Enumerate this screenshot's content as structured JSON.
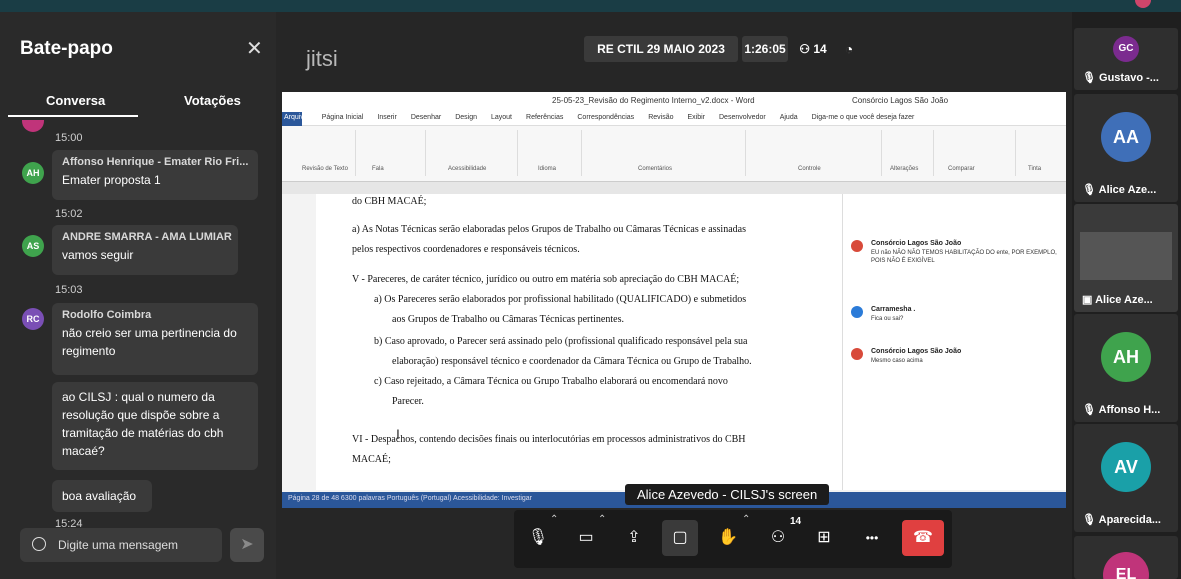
{
  "chat": {
    "title": "Bate-papo",
    "close_icon": "close-icon",
    "tabs": [
      "Conversa",
      "Votações"
    ],
    "messages": [
      {
        "time": "15:00"
      },
      {
        "initials": "AH",
        "color": "#3fa34d",
        "name": "Affonso Henrique - Emater Rio Fri...",
        "text": "Emater proposta 1",
        "time": "15:02"
      },
      {
        "initials": "AS",
        "color": "#3fa34d",
        "name": "ANDRE SMARRA - AMA LUMIAR",
        "text": "vamos seguir",
        "time": "15:03"
      },
      {
        "initials": "RC",
        "color": "#7a4fb5",
        "name": "Rodolfo Coimbra",
        "text": "não creio ser uma pertinencia do regimento"
      },
      {
        "text": "ao CILSJ : qual o numero da resolução que dispõe sobre a tramitação de matérias do cbh macaé?"
      },
      {
        "text": "boa avaliação",
        "time": "15:24"
      }
    ],
    "compose_placeholder": "Digite uma mensagem"
  },
  "header": {
    "logo": "jitsi",
    "meeting_title": "RE CTIL 29 MAIO 2023",
    "timer": "1:26:05",
    "participants_count": "14"
  },
  "shared_screen": {
    "label": "Alice Azevedo - CILSJ's screen",
    "word_title": "25-05-23_Revisão do Regimento Interno_v2.docx - Word",
    "word_user": "Consórcio Lagos São João",
    "ribbon_tabs": [
      "Arquivo",
      "Página Inicial",
      "Inserir",
      "Desenhar",
      "Design",
      "Layout",
      "Referências",
      "Correspondências",
      "Revisão",
      "Exibir",
      "Desenvolvedor",
      "Ajuda",
      "Diga-me o que você deseja fazer"
    ],
    "ribbon_groups": [
      "Revisão de Texto",
      "Fala",
      "Acessibilidade",
      "Idioma",
      "Comentários",
      "Controle",
      "Alterações",
      "Comparar",
      "Tinta"
    ],
    "doc_lines": [
      "do CBH MACAÉ;",
      "a) As Notas Técnicas serão elaboradas pelos Grupos de Trabalho ou Câmaras Técnicas e assinadas",
      "pelos respectivos coordenadores e responsáveis técnicos.",
      "V  - Pareceres, de caráter técnico, jurídico ou outro em matéria sob apreciação do CBH MACAÉ;",
      "a)  Os Pareceres serão elaborados por profissional habilitado (QUALIFICADO) e submetidos",
      "aos Grupos de Trabalho ou Câmaras Técnicas pertinentes.",
      "b)  Caso aprovado, o Parecer será assinado pelo (profissional qualificado responsável pela sua",
      "elaboração) responsável técnico e coordenador da Câmara Técnica ou Grupo de Trabalho.",
      "c)  Caso rejeitado, a Câmara Técnica ou Grupo Trabalho elaborará ou encomendará novo",
      "Parecer.",
      "VI - Despachos, contendo decisões finais ou interlocutórias em processos administrativos do  CBH",
      "MACAÉ;"
    ],
    "comments": [
      {
        "author": "Consórcio Lagos São João",
        "text": "EU não NÃO NÃO TEMOS HABILITAÇÃO DO ente, POR EXEMPLO, POIS NÃO É EXIGÍVEL"
      },
      {
        "author": "Carramesha .",
        "text": "Fica ou sai?"
      },
      {
        "author": "Consórcio Lagos São João",
        "text": "Mesmo caso acima"
      }
    ],
    "status_text": "Página 28 de 48   6300 palavras   Português (Portugal)   Acessibilidade: Investigar"
  },
  "toolbar": {
    "participants_badge": "14",
    "items": [
      "mic-icon",
      "camera-icon",
      "screenshare-icon",
      "chat-icon",
      "raise-hand-icon",
      "participants-icon",
      "tile-view-icon",
      "more-icon",
      "hangup-icon"
    ]
  },
  "participants": [
    {
      "initials": "GC",
      "name": "Gustavo -...",
      "color": "#7b2b8f"
    },
    {
      "initials": "AA",
      "name": "Alice Aze...",
      "color": "#3f6fb8"
    },
    {
      "initials": "",
      "name": "Alice Aze...",
      "color": "#2a2a2a"
    },
    {
      "initials": "AH",
      "name": "Affonso H...",
      "color": "#3fa34d"
    },
    {
      "initials": "AV",
      "name": "Aparecida...",
      "color": "#1aa0a8"
    },
    {
      "initials": "EL",
      "name": "",
      "color": "#c0347a"
    }
  ],
  "colors": {
    "accent": "#1a3d45",
    "hangup": "#e04040",
    "word_blue": "#2b579a"
  }
}
